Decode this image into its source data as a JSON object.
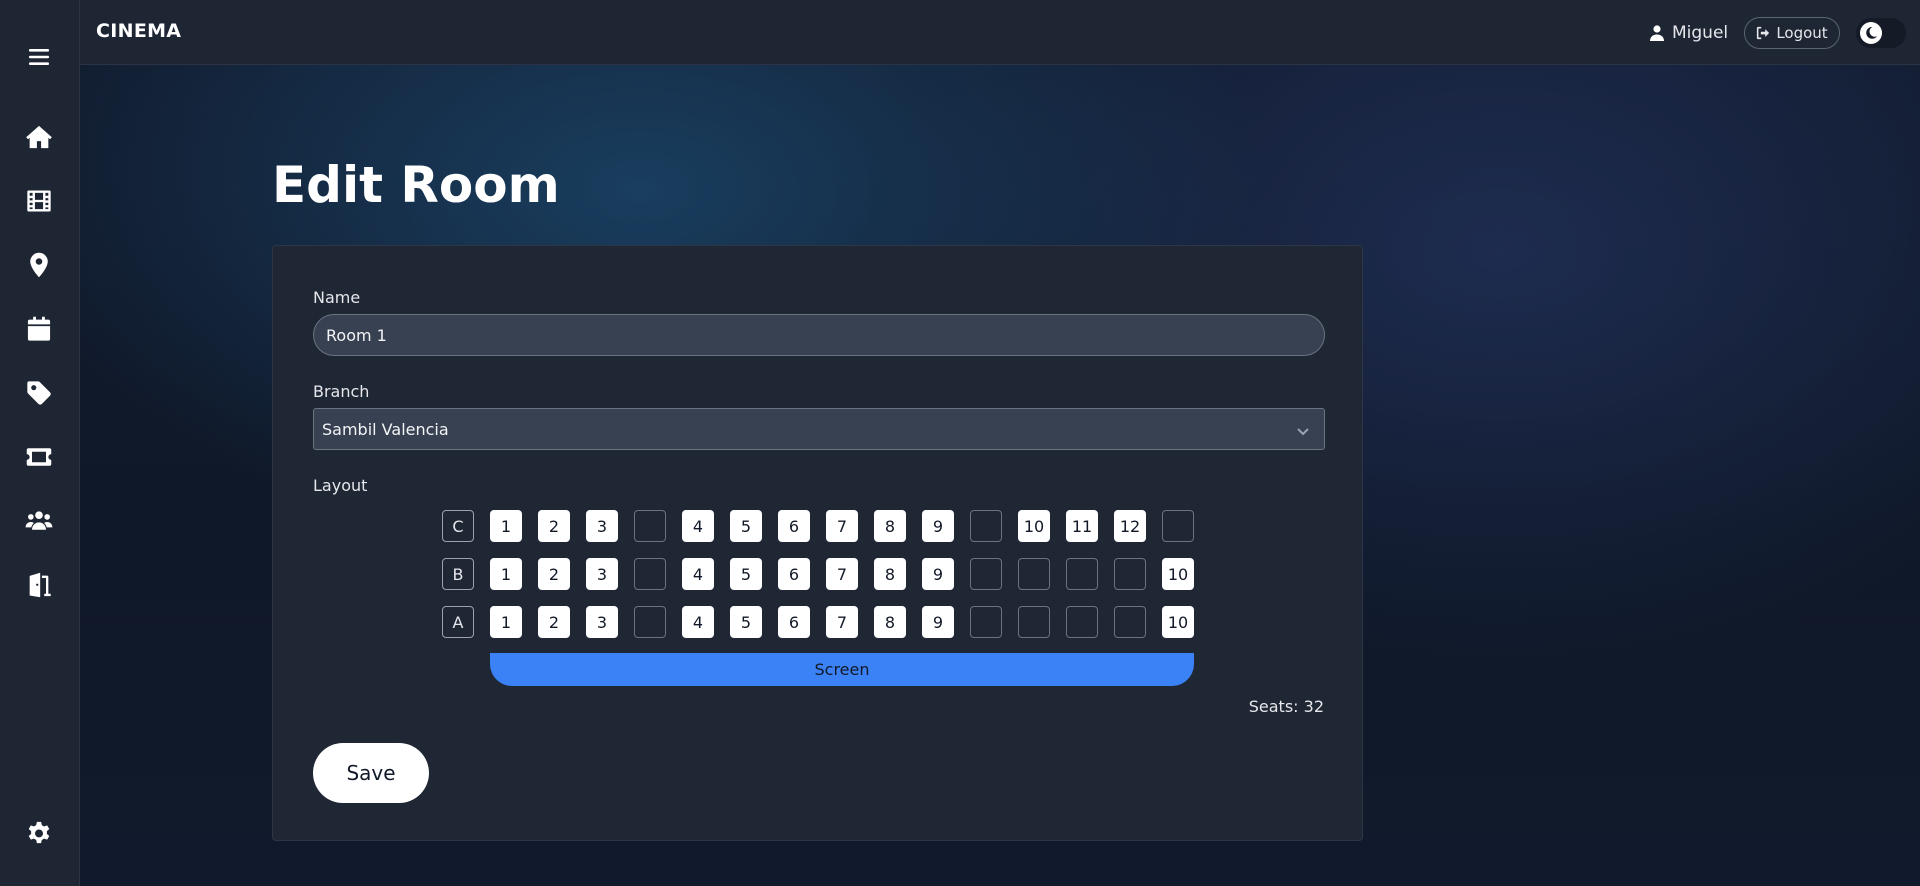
{
  "app": {
    "brand": "CINEMA"
  },
  "topbar": {
    "user_name": "Miguel",
    "logout_label": "Logout"
  },
  "sidebar": {
    "items": [
      {
        "icon": "menu-icon"
      },
      {
        "icon": "home-icon"
      },
      {
        "icon": "film-icon"
      },
      {
        "icon": "location-pin-icon"
      },
      {
        "icon": "calendar-icon"
      },
      {
        "icon": "tag-icon"
      },
      {
        "icon": "ticket-icon"
      },
      {
        "icon": "users-icon"
      },
      {
        "icon": "door-exit-icon"
      },
      {
        "icon": "gear-icon"
      }
    ]
  },
  "page": {
    "title": "Edit Room"
  },
  "form": {
    "name_label": "Name",
    "name_value": "Room 1",
    "branch_label": "Branch",
    "branch_value": "Sambil Valencia",
    "layout_label": "Layout",
    "screen_label": "Screen",
    "seats_text": "Seats: 32",
    "save_label": "Save"
  },
  "layout": {
    "rows": [
      {
        "row": "C",
        "cells": [
          "1",
          "2",
          "3",
          "",
          "4",
          "5",
          "6",
          "7",
          "8",
          "9",
          "",
          "10",
          "11",
          "12",
          ""
        ]
      },
      {
        "row": "B",
        "cells": [
          "1",
          "2",
          "3",
          "",
          "4",
          "5",
          "6",
          "7",
          "8",
          "9",
          "",
          "",
          "",
          "",
          "10"
        ]
      },
      {
        "row": "A",
        "cells": [
          "1",
          "2",
          "3",
          "",
          "4",
          "5",
          "6",
          "7",
          "8",
          "9",
          "",
          "",
          "",
          "",
          "10"
        ]
      }
    ]
  },
  "colors": {
    "accent": "#3b82f6",
    "panel": "#1f2634",
    "sidebar": "#1e2533"
  }
}
